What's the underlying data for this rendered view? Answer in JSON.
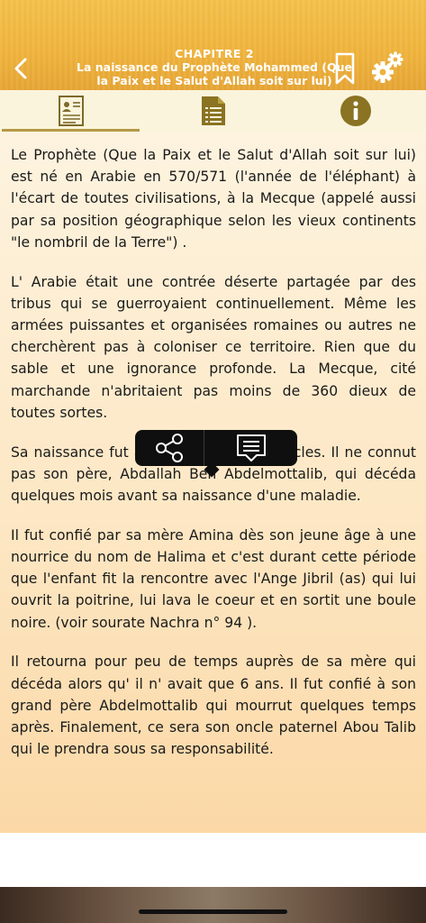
{
  "header": {
    "chapter": "CHAPITRE 2",
    "title_line1": "La naissance du Prophète Mohammed (Que",
    "title_line2": "la Paix et le Salut d'Allah soit sur lui)"
  },
  "tabs": [
    {
      "icon": "profile-card-icon",
      "active": true
    },
    {
      "icon": "document-list-icon",
      "active": false
    },
    {
      "icon": "info-icon",
      "active": false
    }
  ],
  "paragraphs": [
    "Le Prophète (Que la Paix et le Salut d'Allah soit sur lui) est né en Arabie en 570/571 (l'année de l'éléphant) à l'écart de toutes civilisations, à la Mecque (appelé aussi par sa position géographique selon les vieux continents \"le nombril de la Terre\") .",
    "L' Arabie était une contrée déserte partagée par des tribus qui se guerroyaient continuellement. Même les armées puissantes et organisées romaines ou autres ne cherchèrent pas à coloniser ce territoire. Rien que du sable et une ignorance profonde. La Mecque, cité marchande n'abritaient pas moins de 360 dieux de toutes sortes.",
    "Sa naissance fut accompagnée de miracles. Il ne connut pas son père, Abdallah Ben Abdelmottalib, qui décéda quelques mois avant sa naissance d'une maladie.",
    "Il fut confié par sa mère Amina dès son jeune âge à une nourrice du nom de Halima et c'est durant cette période que l'enfant fit la rencontre avec l'Ange Jibril (as) qui lui ouvrit la poitrine, lui lava le coeur et en sortit une boule noire. (voir sourate Nachra n° 94 ).",
    "Il retourna pour peu de temps auprès de sa mère qui décéda alors qu' il n' avait que 6 ans. Il fut confié à son grand père Abdelmottalib qui mourrut quelques temps après. Finalement, ce sera son oncle paternel Abou Talib qui le prendra sous sa responsabilité."
  ],
  "popup": {
    "actions": [
      "share-icon",
      "note-icon"
    ]
  },
  "colors": {
    "header": "#f0b43d",
    "tab_accent": "#b59a47",
    "content_top": "#fdf3df",
    "content_bottom": "#fbd8a6"
  }
}
